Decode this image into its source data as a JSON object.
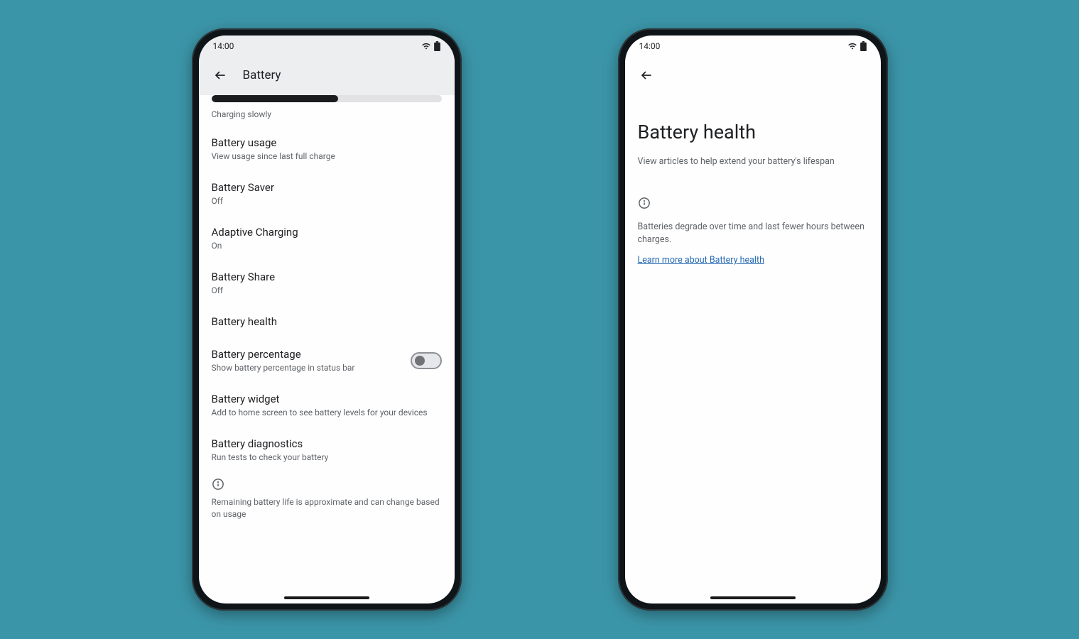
{
  "statusbar": {
    "time": "14:00"
  },
  "screen1": {
    "title": "Battery",
    "charging_status": "Charging slowly",
    "items": {
      "usage": {
        "title": "Battery usage",
        "sub": "View usage since last full charge"
      },
      "saver": {
        "title": "Battery Saver",
        "sub": "Off"
      },
      "adaptive": {
        "title": "Adaptive Charging",
        "sub": "On"
      },
      "share": {
        "title": "Battery Share",
        "sub": "Off"
      },
      "health": {
        "title": "Battery health"
      },
      "percentage": {
        "title": "Battery percentage",
        "sub": "Show battery percentage in status bar"
      },
      "widget": {
        "title": "Battery widget",
        "sub": "Add to home screen to see battery levels for your devices"
      },
      "diagnostics": {
        "title": "Battery diagnostics",
        "sub": "Run tests to check your battery"
      }
    },
    "footnote": "Remaining battery life is approximate and can change based on usage"
  },
  "screen2": {
    "title": "Battery health",
    "subtitle": "View articles to help extend your battery's lifespan",
    "body_text": "Batteries degrade over time and last fewer hours between charges.",
    "link_text": "Learn more about Battery health"
  }
}
